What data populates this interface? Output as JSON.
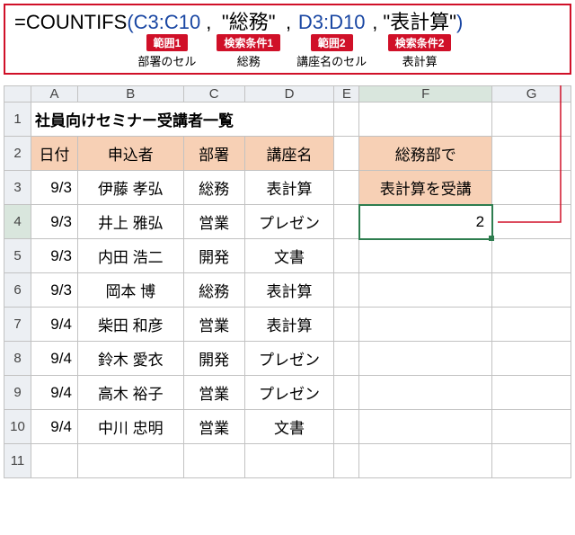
{
  "formula": {
    "eq": "=",
    "fn": "COUNTIFS",
    "open": "(",
    "close": ")",
    "comma": ",",
    "arg1": "C3:C10",
    "arg2": "\"総務\"",
    "arg3": "D3:D10",
    "arg4": "\"表計算\"",
    "ann1_tag": "範囲1",
    "ann1_sub": "部署のセル",
    "ann2_tag": "検索条件1",
    "ann2_sub": "総務",
    "ann3_tag": "範囲2",
    "ann3_sub": "講座名のセル",
    "ann4_tag": "検索条件2",
    "ann4_sub": "表計算"
  },
  "cols": {
    "A": "A",
    "B": "B",
    "C": "C",
    "D": "D",
    "E": "E",
    "F": "F",
    "G": "G"
  },
  "rows": {
    "r1": "1",
    "r2": "2",
    "r3": "3",
    "r4": "4",
    "r5": "5",
    "r6": "6",
    "r7": "7",
    "r8": "8",
    "r9": "9",
    "r10": "10",
    "r11": "11"
  },
  "cells": {
    "title": "社員向けセミナー受講者一覧",
    "h_date": "日付",
    "h_applicant": "申込者",
    "h_dept": "部署",
    "h_course": "講座名",
    "f2": "総務部で",
    "f3": "表計算を受講",
    "f4": "2",
    "data": [
      {
        "date": "9/3",
        "name": "伊藤 孝弘",
        "dept": "総務",
        "course": "表計算"
      },
      {
        "date": "9/3",
        "name": "井上 雅弘",
        "dept": "営業",
        "course": "プレゼン"
      },
      {
        "date": "9/3",
        "name": "内田 浩二",
        "dept": "開発",
        "course": "文書"
      },
      {
        "date": "9/3",
        "name": "岡本 博",
        "dept": "総務",
        "course": "表計算"
      },
      {
        "date": "9/4",
        "name": "柴田 和彦",
        "dept": "営業",
        "course": "表計算"
      },
      {
        "date": "9/4",
        "name": "鈴木 愛衣",
        "dept": "開発",
        "course": "プレゼン"
      },
      {
        "date": "9/4",
        "name": "高木 裕子",
        "dept": "営業",
        "course": "プレゼン"
      },
      {
        "date": "9/4",
        "name": "中川 忠明",
        "dept": "営業",
        "course": "文書"
      }
    ]
  },
  "chart_data": {
    "type": "table",
    "title": "社員向けセミナー受講者一覧",
    "columns": [
      "日付",
      "申込者",
      "部署",
      "講座名"
    ],
    "rows": [
      [
        "9/3",
        "伊藤 孝弘",
        "総務",
        "表計算"
      ],
      [
        "9/3",
        "井上 雅弘",
        "営業",
        "プレゼン"
      ],
      [
        "9/3",
        "内田 浩二",
        "開発",
        "文書"
      ],
      [
        "9/3",
        "岡本 博",
        "総務",
        "表計算"
      ],
      [
        "9/4",
        "柴田 和彦",
        "営業",
        "表計算"
      ],
      [
        "9/4",
        "鈴木 愛衣",
        "開発",
        "プレゼン"
      ],
      [
        "9/4",
        "高木 裕子",
        "営業",
        "プレゼン"
      ],
      [
        "9/4",
        "中川 忠明",
        "営業",
        "文書"
      ]
    ],
    "formula_result": {
      "label": "総務部で 表計算を受講",
      "value": 2,
      "formula": "=COUNTIFS(C3:C10,\"総務\",D3:D10,\"表計算\")"
    }
  }
}
